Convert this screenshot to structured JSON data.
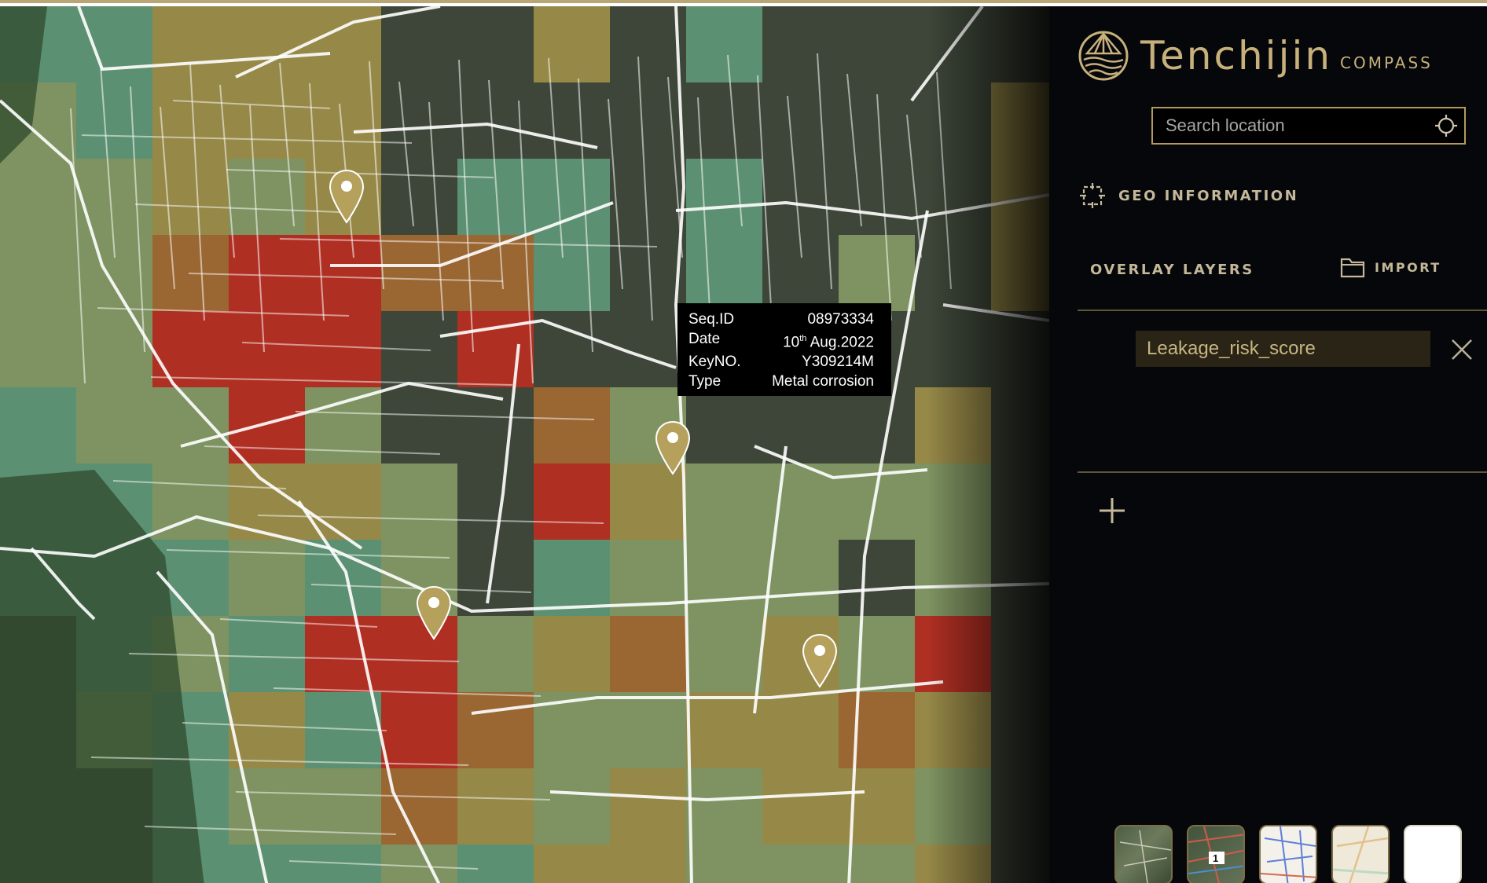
{
  "map": {
    "tooltip": {
      "rows": [
        {
          "key": "Seq.ID",
          "value": "08973334"
        },
        {
          "key": "Date",
          "value_day": "10",
          "value_suffix": "th",
          "value_rest": " Aug.2022"
        },
        {
          "key": "KeyNO.",
          "value": "Y309214M"
        },
        {
          "key": "Type",
          "value": "Metal corrosion"
        }
      ]
    },
    "pin_icon": "map-pin-icon",
    "risk_colors": {
      "high": "#c42a1e",
      "medium_high": "#d77a2b",
      "medium": "#d1b24e",
      "low_medium": "#a9c57a",
      "low": "#6fbf96"
    }
  },
  "panel": {
    "brand_name": "Tenchijin",
    "brand_sub": "COMPASS",
    "search_placeholder": "Search location",
    "geo_information_label": "GEO INFORMATION",
    "overlay_layers_label": "OVERLAY LAYERS",
    "import_label": "IMPORT",
    "layers": [
      {
        "name": "Leakage_risk_score"
      }
    ],
    "basemap_thumbnails": [
      {
        "name": "satellite"
      },
      {
        "name": "pipeline-map",
        "badge": "1"
      },
      {
        "name": "street-map"
      },
      {
        "name": "light-map"
      },
      {
        "name": "blank"
      }
    ],
    "accent_color": "#b49a5c"
  }
}
